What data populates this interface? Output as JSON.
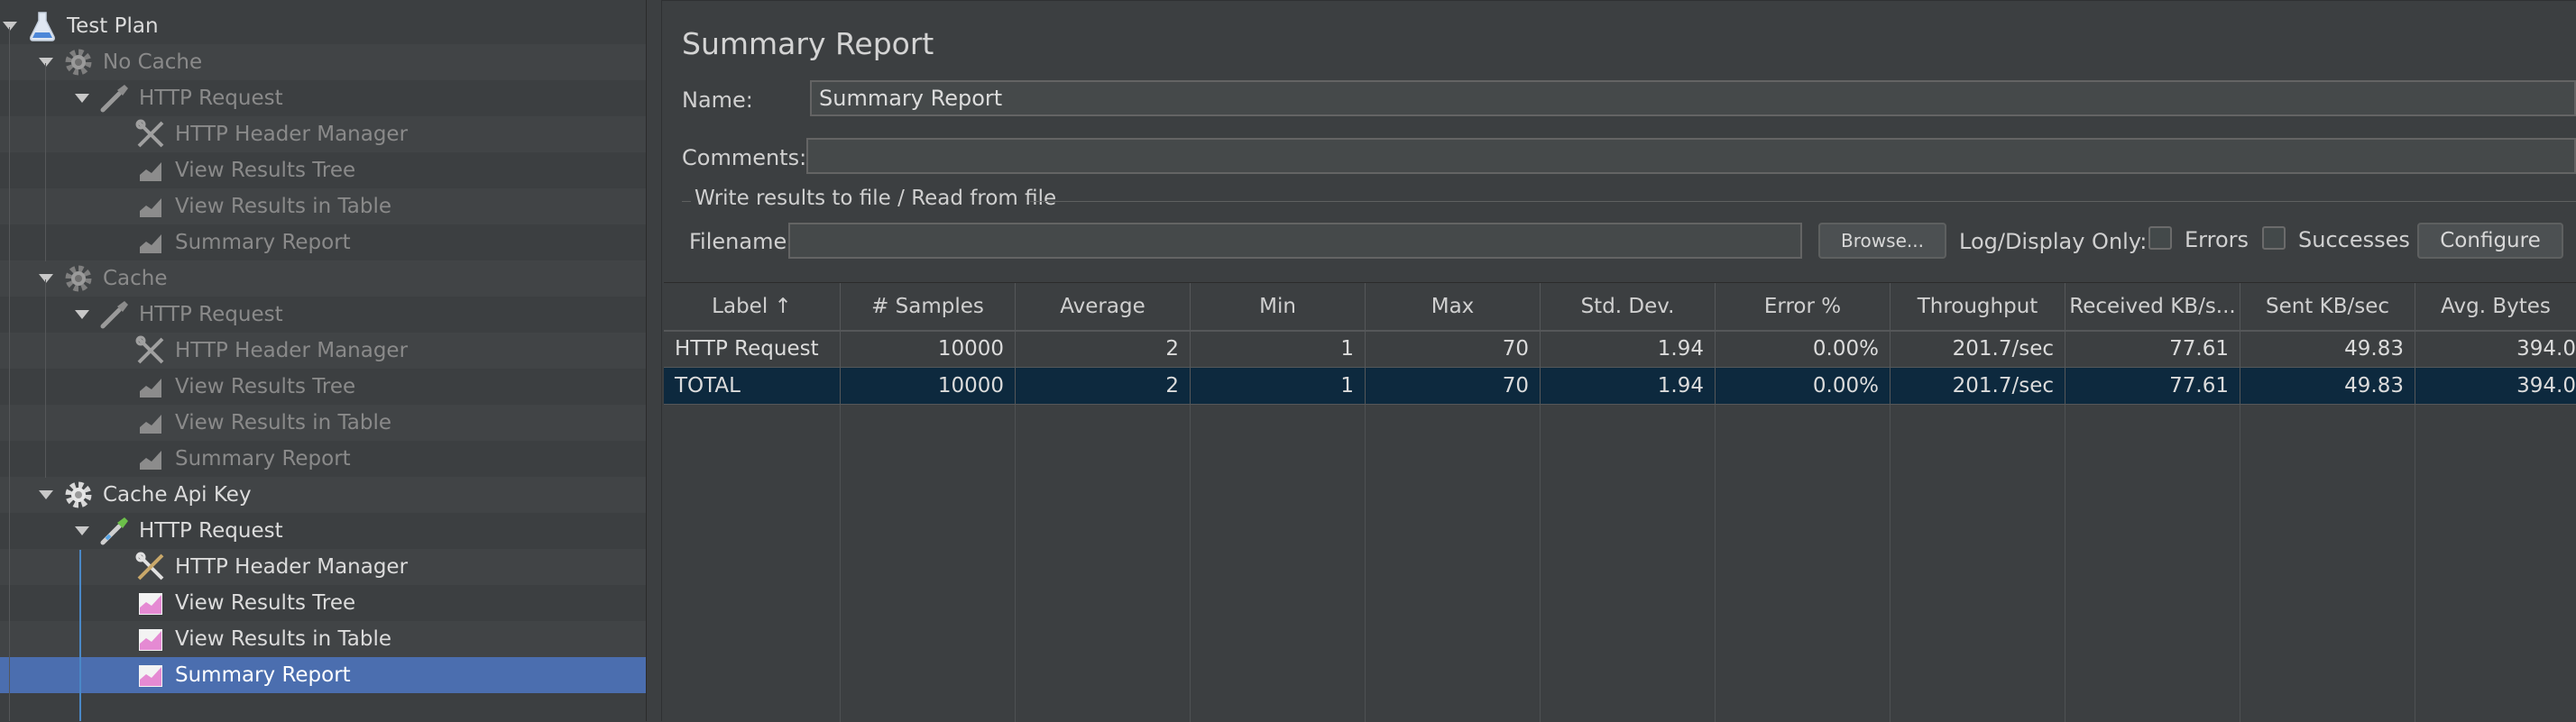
{
  "tree": {
    "items": [
      {
        "label": "Test Plan",
        "icon": "flask-icon",
        "state": "enabled",
        "toggle": true
      },
      {
        "label": "No Cache",
        "icon": "gear-icon",
        "state": "disabled",
        "toggle": true
      },
      {
        "label": "HTTP Request",
        "icon": "pipette-icon",
        "state": "disabled",
        "toggle": true
      },
      {
        "label": "HTTP Header Manager",
        "icon": "tools-icon",
        "state": "disabled",
        "toggle": false
      },
      {
        "label": "View Results Tree",
        "icon": "chart-icon",
        "state": "disabled",
        "toggle": false
      },
      {
        "label": "View Results in Table",
        "icon": "chart-icon",
        "state": "disabled",
        "toggle": false
      },
      {
        "label": "Summary Report",
        "icon": "chart-icon",
        "state": "disabled",
        "toggle": false
      },
      {
        "label": "Cache",
        "icon": "gear-icon",
        "state": "disabled",
        "toggle": true
      },
      {
        "label": "HTTP Request",
        "icon": "pipette-icon",
        "state": "disabled",
        "toggle": true
      },
      {
        "label": "HTTP Header Manager",
        "icon": "tools-icon",
        "state": "disabled",
        "toggle": false
      },
      {
        "label": "View Results Tree",
        "icon": "chart-icon",
        "state": "disabled",
        "toggle": false
      },
      {
        "label": "View Results in Table",
        "icon": "chart-icon",
        "state": "disabled",
        "toggle": false
      },
      {
        "label": "Summary Report",
        "icon": "chart-icon",
        "state": "disabled",
        "toggle": false
      },
      {
        "label": "Cache Api Key",
        "icon": "gear-icon",
        "state": "enabled",
        "toggle": true
      },
      {
        "label": "HTTP Request",
        "icon": "pipette-icon",
        "state": "enabled",
        "toggle": true
      },
      {
        "label": "HTTP Header Manager",
        "icon": "tools-icon",
        "state": "enabled",
        "toggle": false
      },
      {
        "label": "View Results Tree",
        "icon": "chart-icon",
        "state": "enabled",
        "toggle": false
      },
      {
        "label": "View Results in Table",
        "icon": "chart-icon",
        "state": "enabled",
        "toggle": false
      },
      {
        "label": "Summary Report",
        "icon": "chart-icon",
        "state": "selected",
        "toggle": false
      }
    ]
  },
  "panel": {
    "title": "Summary Report",
    "name_label": "Name:",
    "name_value": "Summary Report",
    "comments_label": "Comments:",
    "comments_value": "",
    "group_title": "Write results to file / Read from file",
    "filename_label": "Filename",
    "filename_value": "",
    "browse_label": "Browse...",
    "log_display_label": "Log/Display Only:",
    "errors_label": "Errors",
    "successes_label": "Successes",
    "configure_label": "Configure"
  },
  "table": {
    "headers": [
      "Label ↑",
      "# Samples",
      "Average",
      "Min",
      "Max",
      "Std. Dev.",
      "Error %",
      "Throughput",
      "Received KB/s...",
      "Sent KB/sec",
      "Avg. Bytes"
    ],
    "rows": [
      [
        "HTTP Request",
        "10000",
        "2",
        "1",
        "70",
        "1.94",
        "0.00%",
        "201.7/sec",
        "77.61",
        "49.83",
        "394.0"
      ],
      [
        "TOTAL",
        "10000",
        "2",
        "1",
        "70",
        "1.94",
        "0.00%",
        "201.7/sec",
        "77.61",
        "49.83",
        "394.0"
      ]
    ]
  },
  "colors": {
    "background": "#3c3f41",
    "selection": "#4b6eaf",
    "table_selection": "#0d293e"
  }
}
